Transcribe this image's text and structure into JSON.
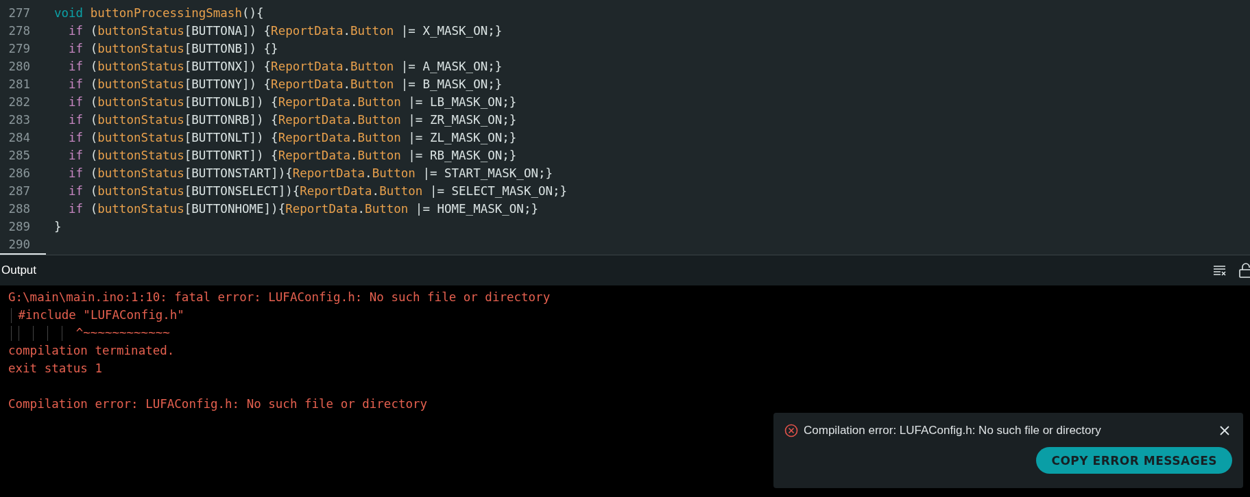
{
  "editor": {
    "lines": [
      {
        "number": "277",
        "tokens": [
          {
            "kind": "keyword",
            "text": "void"
          },
          {
            "kind": "name",
            "text": " buttonProcessingSmash"
          },
          {
            "kind": "plain",
            "text": "(){"
          }
        ]
      },
      {
        "number": "278",
        "tokens": [
          {
            "kind": "control",
            "text": "  if"
          },
          {
            "kind": "plain",
            "text": " ("
          },
          {
            "kind": "name",
            "text": "buttonStatus"
          },
          {
            "kind": "plain",
            "text": "[BUTTONA]) {"
          },
          {
            "kind": "name",
            "text": "ReportData"
          },
          {
            "kind": "plain",
            "text": "."
          },
          {
            "kind": "name",
            "text": "Button"
          },
          {
            "kind": "plain",
            "text": " |= X_MASK_ON;}"
          }
        ]
      },
      {
        "number": "279",
        "tokens": [
          {
            "kind": "control",
            "text": "  if"
          },
          {
            "kind": "plain",
            "text": " ("
          },
          {
            "kind": "name",
            "text": "buttonStatus"
          },
          {
            "kind": "plain",
            "text": "[BUTTONB]) {}"
          }
        ]
      },
      {
        "number": "280",
        "tokens": [
          {
            "kind": "control",
            "text": "  if"
          },
          {
            "kind": "plain",
            "text": " ("
          },
          {
            "kind": "name",
            "text": "buttonStatus"
          },
          {
            "kind": "plain",
            "text": "[BUTTONX]) {"
          },
          {
            "kind": "name",
            "text": "ReportData"
          },
          {
            "kind": "plain",
            "text": "."
          },
          {
            "kind": "name",
            "text": "Button"
          },
          {
            "kind": "plain",
            "text": " |= A_MASK_ON;}"
          }
        ]
      },
      {
        "number": "281",
        "tokens": [
          {
            "kind": "control",
            "text": "  if"
          },
          {
            "kind": "plain",
            "text": " ("
          },
          {
            "kind": "name",
            "text": "buttonStatus"
          },
          {
            "kind": "plain",
            "text": "[BUTTONY]) {"
          },
          {
            "kind": "name",
            "text": "ReportData"
          },
          {
            "kind": "plain",
            "text": "."
          },
          {
            "kind": "name",
            "text": "Button"
          },
          {
            "kind": "plain",
            "text": " |= B_MASK_ON;}"
          }
        ]
      },
      {
        "number": "282",
        "tokens": [
          {
            "kind": "control",
            "text": "  if"
          },
          {
            "kind": "plain",
            "text": " ("
          },
          {
            "kind": "name",
            "text": "buttonStatus"
          },
          {
            "kind": "plain",
            "text": "[BUTTONLB]) {"
          },
          {
            "kind": "name",
            "text": "ReportData"
          },
          {
            "kind": "plain",
            "text": "."
          },
          {
            "kind": "name",
            "text": "Button"
          },
          {
            "kind": "plain",
            "text": " |= LB_MASK_ON;}"
          }
        ]
      },
      {
        "number": "283",
        "tokens": [
          {
            "kind": "control",
            "text": "  if"
          },
          {
            "kind": "plain",
            "text": " ("
          },
          {
            "kind": "name",
            "text": "buttonStatus"
          },
          {
            "kind": "plain",
            "text": "[BUTTONRB]) {"
          },
          {
            "kind": "name",
            "text": "ReportData"
          },
          {
            "kind": "plain",
            "text": "."
          },
          {
            "kind": "name",
            "text": "Button"
          },
          {
            "kind": "plain",
            "text": " |= ZR_MASK_ON;}"
          }
        ]
      },
      {
        "number": "284",
        "tokens": [
          {
            "kind": "control",
            "text": "  if"
          },
          {
            "kind": "plain",
            "text": " ("
          },
          {
            "kind": "name",
            "text": "buttonStatus"
          },
          {
            "kind": "plain",
            "text": "[BUTTONLT]) {"
          },
          {
            "kind": "name",
            "text": "ReportData"
          },
          {
            "kind": "plain",
            "text": "."
          },
          {
            "kind": "name",
            "text": "Button"
          },
          {
            "kind": "plain",
            "text": " |= ZL_MASK_ON;}"
          }
        ]
      },
      {
        "number": "285",
        "tokens": [
          {
            "kind": "control",
            "text": "  if"
          },
          {
            "kind": "plain",
            "text": " ("
          },
          {
            "kind": "name",
            "text": "buttonStatus"
          },
          {
            "kind": "plain",
            "text": "[BUTTONRT]) {"
          },
          {
            "kind": "name",
            "text": "ReportData"
          },
          {
            "kind": "plain",
            "text": "."
          },
          {
            "kind": "name",
            "text": "Button"
          },
          {
            "kind": "plain",
            "text": " |= RB_MASK_ON;}"
          }
        ]
      },
      {
        "number": "286",
        "tokens": [
          {
            "kind": "control",
            "text": "  if"
          },
          {
            "kind": "plain",
            "text": " ("
          },
          {
            "kind": "name",
            "text": "buttonStatus"
          },
          {
            "kind": "plain",
            "text": "[BUTTONSTART]){"
          },
          {
            "kind": "name",
            "text": "ReportData"
          },
          {
            "kind": "plain",
            "text": "."
          },
          {
            "kind": "name",
            "text": "Button"
          },
          {
            "kind": "plain",
            "text": " |= START_MASK_ON;}"
          }
        ]
      },
      {
        "number": "287",
        "tokens": [
          {
            "kind": "control",
            "text": "  if"
          },
          {
            "kind": "plain",
            "text": " ("
          },
          {
            "kind": "name",
            "text": "buttonStatus"
          },
          {
            "kind": "plain",
            "text": "[BUTTONSELECT]){"
          },
          {
            "kind": "name",
            "text": "ReportData"
          },
          {
            "kind": "plain",
            "text": "."
          },
          {
            "kind": "name",
            "text": "Button"
          },
          {
            "kind": "plain",
            "text": " |= SELECT_MASK_ON;}"
          }
        ]
      },
      {
        "number": "288",
        "tokens": [
          {
            "kind": "control",
            "text": "  if"
          },
          {
            "kind": "plain",
            "text": " ("
          },
          {
            "kind": "name",
            "text": "buttonStatus"
          },
          {
            "kind": "plain",
            "text": "[BUTTONHOME]){"
          },
          {
            "kind": "name",
            "text": "ReportData"
          },
          {
            "kind": "plain",
            "text": "."
          },
          {
            "kind": "name",
            "text": "Button"
          },
          {
            "kind": "plain",
            "text": " |= HOME_MASK_ON;}"
          }
        ]
      },
      {
        "number": "289",
        "tokens": [
          {
            "kind": "plain",
            "text": "}"
          }
        ]
      },
      {
        "number": "290"
      }
    ]
  },
  "output": {
    "title": "Output",
    "lines": [
      "G:\\main\\main.ino:1:10: fatal error: LUFAConfig.h: No such file or directory",
      "\t#include \"LUFAConfig.h\"",
      "\t\t\t\t\t^~~~~~~~~~~~~",
      "compilation terminated.",
      "exit status 1",
      "Compilation error: LUFAConfig.h: No such file or directory"
    ]
  },
  "notification": {
    "message": "Compilation error: LUFAConfig.h: No such file or directory",
    "button": "COPY ERROR MESSAGES"
  }
}
